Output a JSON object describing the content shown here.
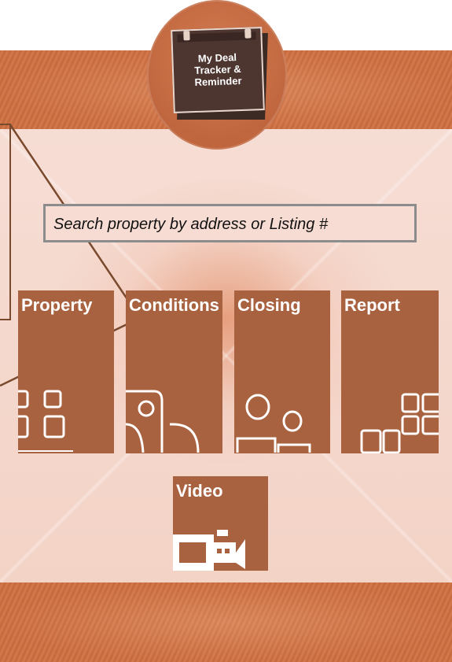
{
  "app": {
    "title_lines": "My Deal\nTracker &\nReminder"
  },
  "search": {
    "placeholder": "Search property by address or Listing #"
  },
  "tiles": [
    {
      "id": "property",
      "label": "Property",
      "icon": "grid-squares-icon"
    },
    {
      "id": "conditions",
      "label": "Conditions",
      "icon": "document-checklist-icon"
    },
    {
      "id": "closing",
      "label": "Closing",
      "icon": "people-icon"
    },
    {
      "id": "report",
      "label": "Report",
      "icon": "report-grid-icon"
    },
    {
      "id": "video",
      "label": "Video",
      "icon": "video-camera-icon"
    }
  ],
  "colors": {
    "tile": "#a8623f",
    "band": "#c2653a",
    "background": "#f6ddd4",
    "connector": "#7a4a2e"
  }
}
